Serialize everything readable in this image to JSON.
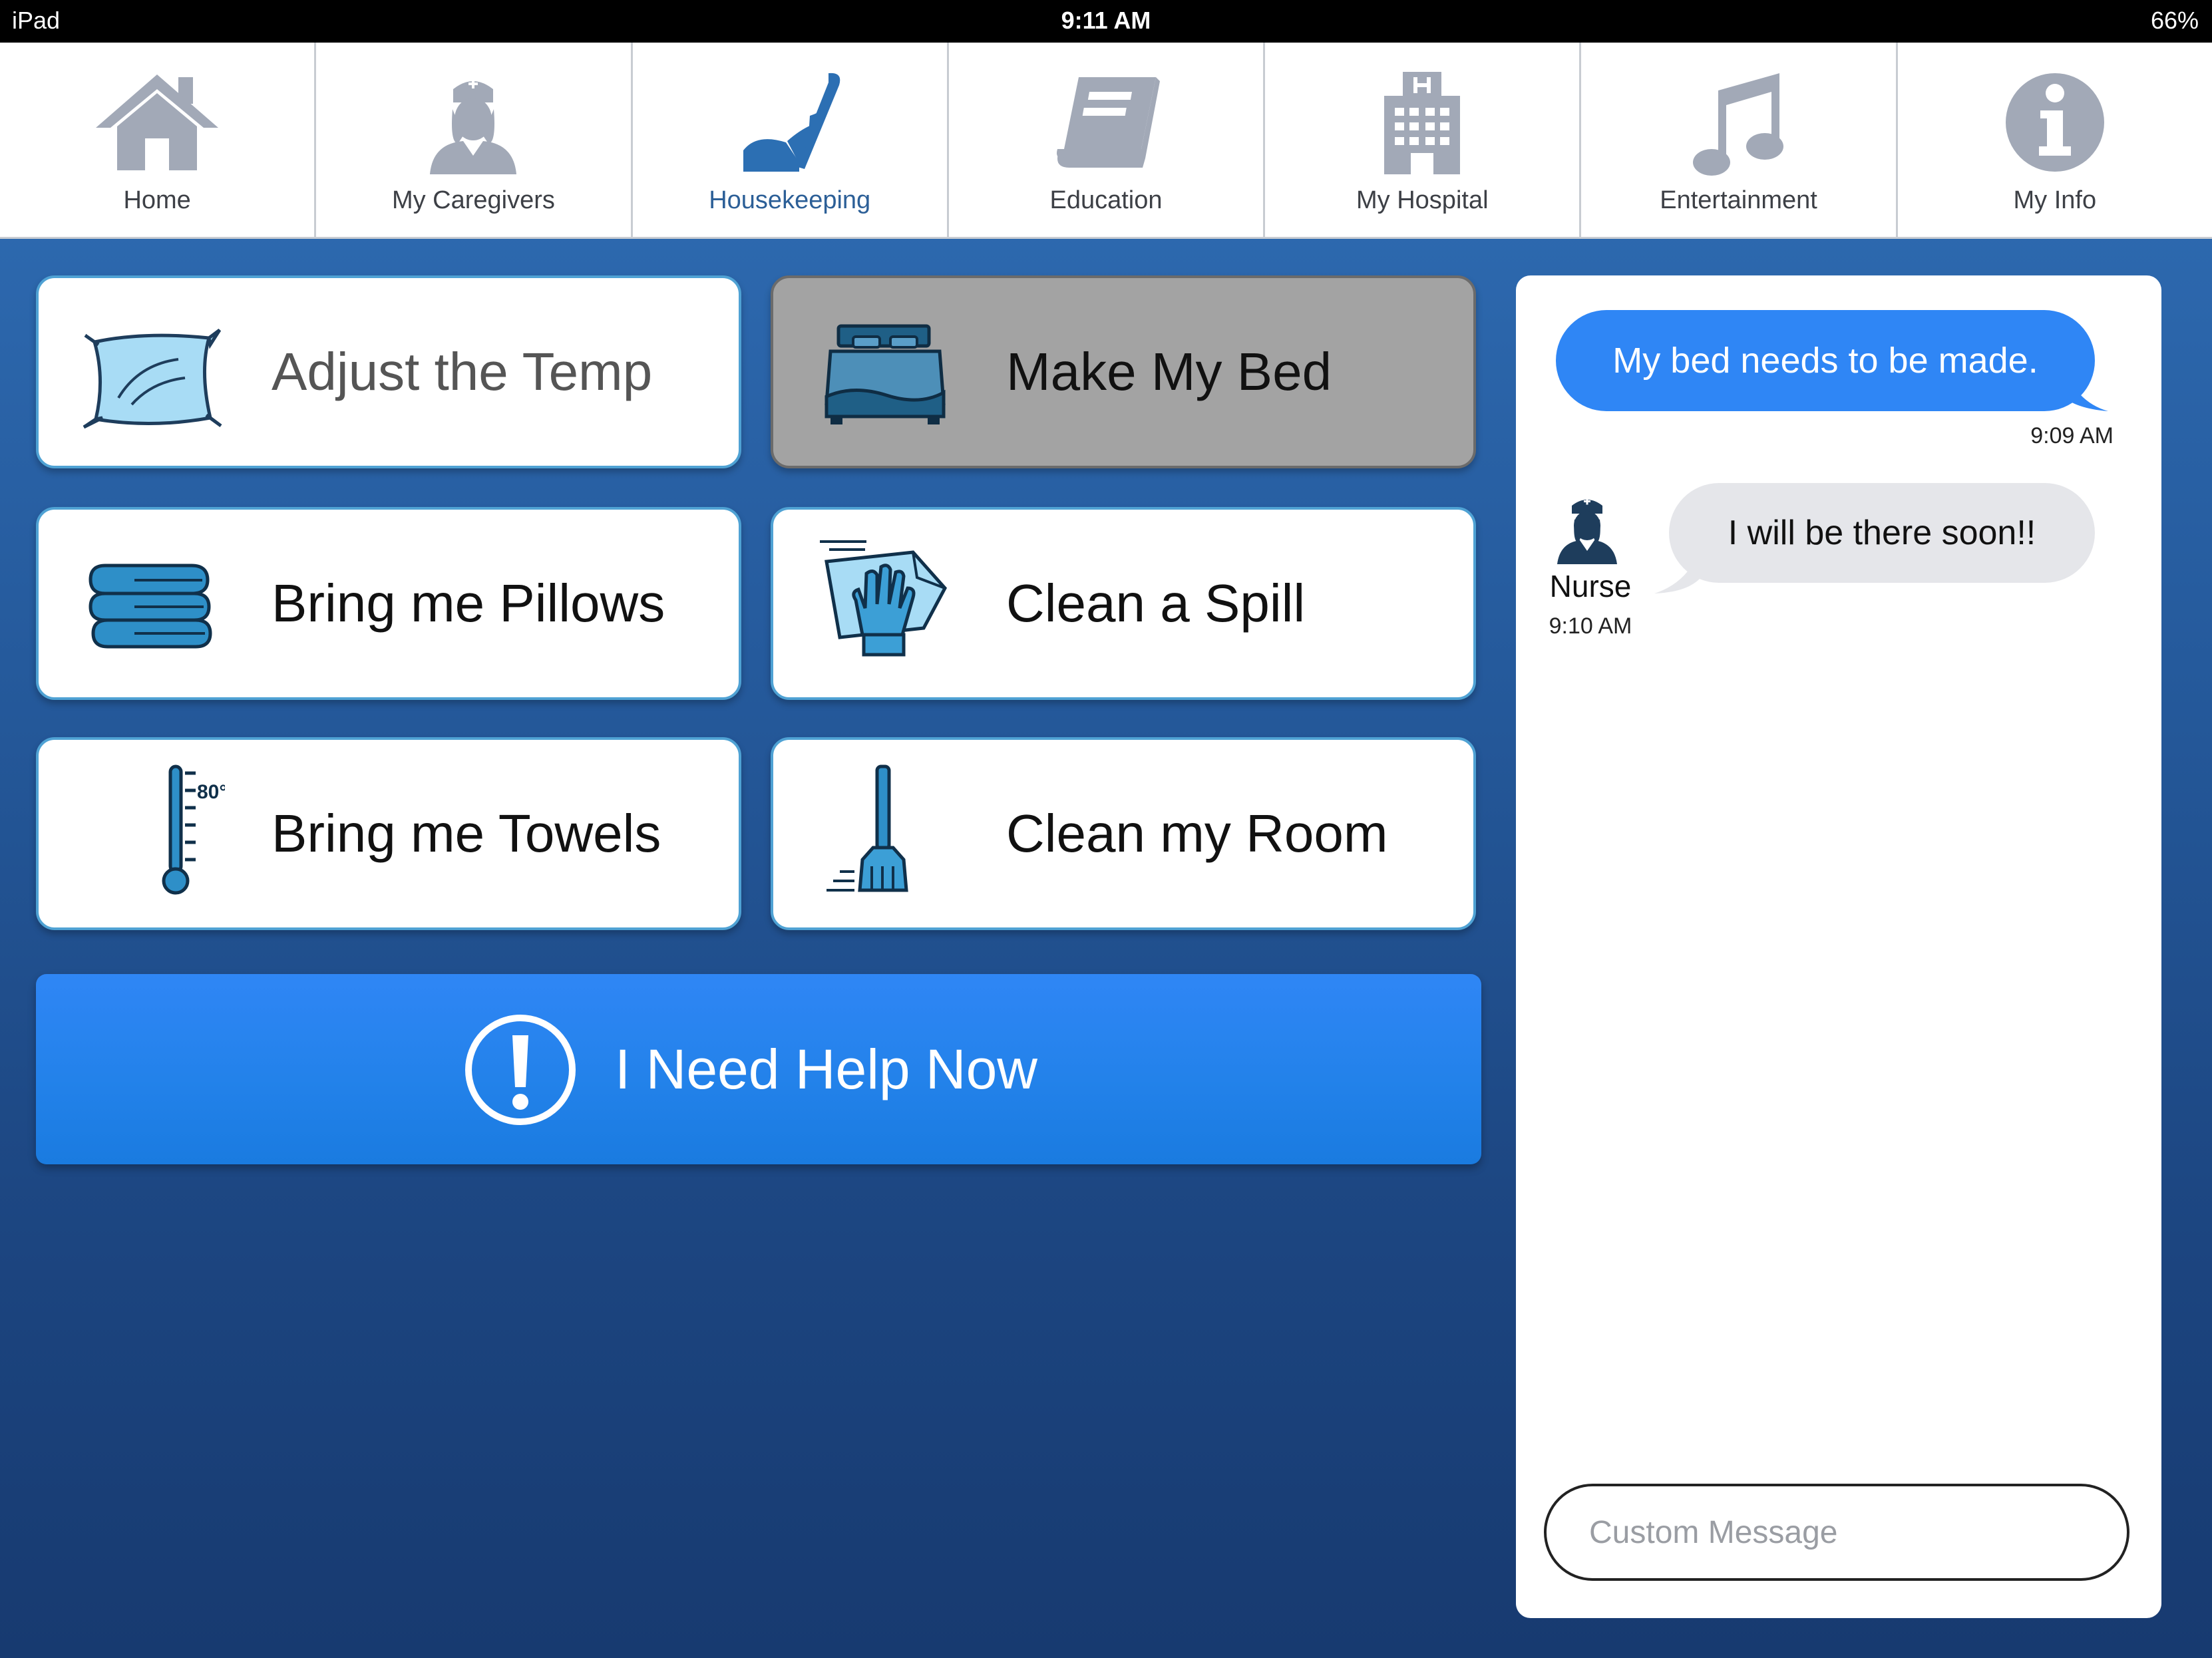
{
  "status_bar": {
    "device": "iPad",
    "time": "9:11 AM",
    "battery": "66%"
  },
  "nav": {
    "items": [
      {
        "label": "Home",
        "icon": "home-icon"
      },
      {
        "label": "My Caregivers",
        "icon": "nurse-icon"
      },
      {
        "label": "Housekeeping",
        "icon": "vacuum-icon",
        "active": true
      },
      {
        "label": "Education",
        "icon": "book-icon"
      },
      {
        "label": "My Hospital",
        "icon": "hospital-icon"
      },
      {
        "label": "Entertainment",
        "icon": "music-note-icon"
      },
      {
        "label": "My Info",
        "icon": "info-icon"
      }
    ]
  },
  "actions": {
    "adjust_temp": {
      "label": "Adjust the Temp",
      "icon": "pillow-icon"
    },
    "make_bed": {
      "label": "Make My Bed",
      "icon": "bed-icon",
      "selected": true
    },
    "bring_pillows": {
      "label": "Bring me Pillows",
      "icon": "folded-towels-icon"
    },
    "clean_spill": {
      "label": "Clean a Spill",
      "icon": "glove-cloth-icon"
    },
    "bring_towels": {
      "label": "Bring me Towels",
      "icon": "thermometer-icon",
      "thermometer_text": "80°"
    },
    "clean_room": {
      "label": "Clean my Room",
      "icon": "broom-icon"
    }
  },
  "help": {
    "label": "I Need Help Now",
    "icon": "exclamation-circle-icon"
  },
  "chat": {
    "messages": [
      {
        "from": "me",
        "text": "My bed needs to be made.",
        "time": "9:09 AM"
      },
      {
        "from": "Nurse",
        "text": "I will be there soon!!",
        "time": "9:10 AM"
      }
    ],
    "input_placeholder": "Custom Message"
  },
  "colors": {
    "accent_blue": "#2f86f5",
    "nav_icon_gray": "#a2a9b7",
    "active_nav": "#2c5f97",
    "card_border": "#4fa2d4",
    "selected_card": "#a3a3a3"
  }
}
